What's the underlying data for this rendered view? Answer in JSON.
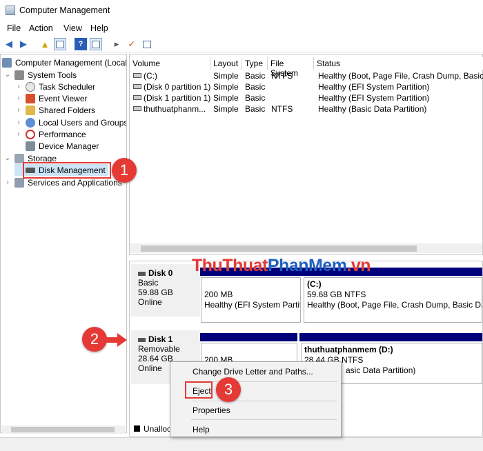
{
  "window": {
    "title": "Computer Management"
  },
  "menubar": [
    "File",
    "Action",
    "View",
    "Help"
  ],
  "tree": {
    "items": [
      {
        "label": "Computer Management (Local",
        "level": 0,
        "expander": "",
        "icon": "computer-icon"
      },
      {
        "label": "System Tools",
        "level": 1,
        "expander": "v",
        "icon": "tools-icon"
      },
      {
        "label": "Task Scheduler",
        "level": 2,
        "expander": ">",
        "icon": "clock-icon"
      },
      {
        "label": "Event Viewer",
        "level": 2,
        "expander": ">",
        "icon": "event-viewer-icon"
      },
      {
        "label": "Shared Folders",
        "level": 2,
        "expander": ">",
        "icon": "shared-folder-icon"
      },
      {
        "label": "Local Users and Groups",
        "level": 2,
        "expander": ">",
        "icon": "users-icon"
      },
      {
        "label": "Performance",
        "level": 2,
        "expander": ">",
        "icon": "performance-icon"
      },
      {
        "label": "Device Manager",
        "level": 2,
        "expander": "",
        "icon": "device-manager-icon"
      },
      {
        "label": "Storage",
        "level": 0,
        "expander": "v",
        "icon": "storage-icon"
      },
      {
        "label": "Disk Management",
        "level": 2,
        "expander": "",
        "icon": "disk-icon"
      },
      {
        "label": "Services and Applications",
        "level": 0,
        "expander": ">",
        "icon": "services-icon"
      }
    ]
  },
  "volumes": {
    "columns": [
      "Volume",
      "Layout",
      "Type",
      "File System",
      "Status"
    ],
    "rows": [
      [
        "(C:)",
        "Simple",
        "Basic",
        "NTFS",
        "Healthy (Boot, Page File, Crash Dump, Basic Da"
      ],
      [
        "(Disk 0 partition 1)",
        "Simple",
        "Basic",
        "",
        "Healthy (EFI System Partition)"
      ],
      [
        "(Disk 1 partition 1)",
        "Simple",
        "Basic",
        "",
        "Healthy (EFI System Partition)"
      ],
      [
        "thuthuatphanm...",
        "Simple",
        "Basic",
        "NTFS",
        "Healthy (Basic Data Partition)"
      ]
    ]
  },
  "disks": [
    {
      "name": "Disk 0",
      "type": "Basic",
      "size": "59.88 GB",
      "status": "Online",
      "partitions": [
        {
          "title": "",
          "size": "200 MB",
          "status": "Healthy (EFI System Partiti"
        },
        {
          "title": "(C:)",
          "size": "59.68 GB NTFS",
          "status": "Healthy (Boot, Page File, Crash Dump, Basic Data P"
        }
      ]
    },
    {
      "name": "Disk 1",
      "type": "Removable",
      "size": "28.64 GB",
      "status": "Online",
      "partitions": [
        {
          "title": "",
          "size": "200 MB",
          "status": ""
        },
        {
          "title": "thuthuatphanmem  (D:)",
          "size": "28.44 GB NTFS",
          "status": "asic Data Partition)"
        }
      ]
    }
  ],
  "legend": {
    "unallocated": "Unalloc"
  },
  "context_menu": [
    "Change Drive Letter and Paths...",
    "Eject",
    "Properties",
    "Help"
  ],
  "annotations": {
    "step1": "1",
    "step2": "2",
    "step3": "3"
  },
  "watermark": {
    "part1": "ThuThuat",
    "part2": "PhanMem",
    "part3": ".vn"
  },
  "colors": {
    "accent_red": "#e53935",
    "partition_bar": "#00007a",
    "watermark_blue": "#1f5fbf"
  }
}
